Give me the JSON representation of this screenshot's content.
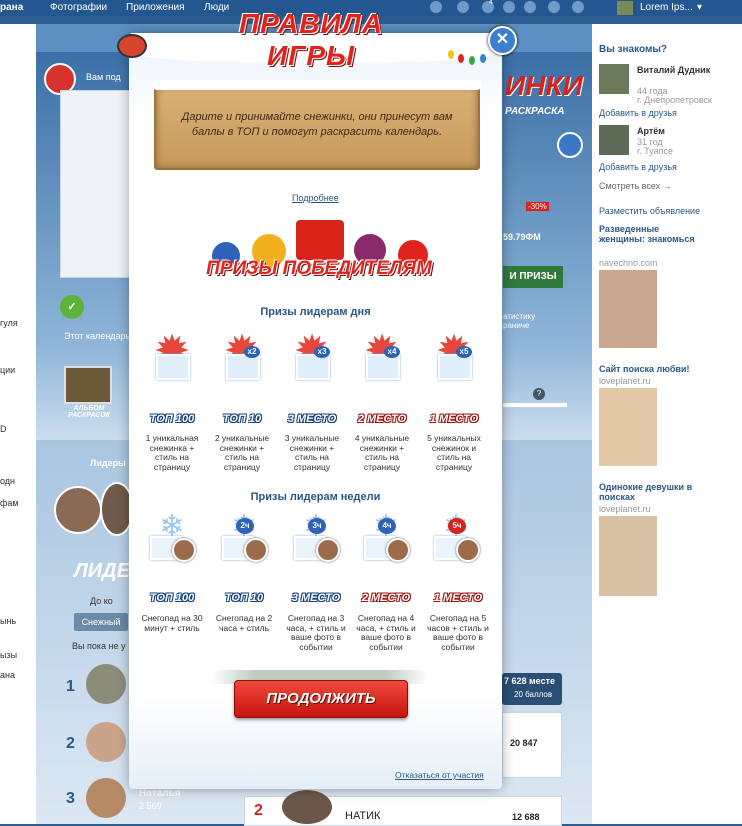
{
  "topbar": {
    "brand_fragment": "рана",
    "nav": [
      "Фотографии",
      "Приложения",
      "Люди"
    ],
    "notification_count": "4",
    "user_name": "Lorem Ips..."
  },
  "modal": {
    "title": "ПРАВИЛА ИГРЫ",
    "rules_text": "Дарите и принимайте снежинки, они принесут вам баллы в ТОП и помогут раскрасить календарь.",
    "more_link": "Подробнее",
    "prizes_banner": "ПРИЗЫ ПОБЕДИТЕЛЯМ",
    "day_section_title": "Призы лидерам дня",
    "week_section_title": "Призы лидерам недели",
    "day_prizes": [
      {
        "place": "ТОП 100",
        "multiplier": "",
        "desc": "1 уникальная снежинка + стиль на страницу"
      },
      {
        "place": "ТОП 10",
        "multiplier": "x2",
        "desc": "2 уникальные снежинки + стиль на страницу"
      },
      {
        "place": "3 МЕСТО",
        "multiplier": "x3",
        "desc": "3 уникальные снежинки + стиль на страницу"
      },
      {
        "place": "2 МЕСТО",
        "multiplier": "x4",
        "desc": "4 уникальные снежинки + стиль на страницу"
      },
      {
        "place": "1 МЕСТО",
        "multiplier": "x5",
        "desc": "5 уникальных снежинок и стиль на страницу"
      }
    ],
    "week_prizes": [
      {
        "place": "ТОП 100",
        "badge": "",
        "desc": "Снегопад на 30 минут + стиль"
      },
      {
        "place": "ТОП 10",
        "badge": "2ч",
        "desc": "Снегопад на 2 часа + стиль"
      },
      {
        "place": "3 МЕСТО",
        "badge": "3ч",
        "desc": "Снегопад на 3 часа, + стиль и ваше фото в событии"
      },
      {
        "place": "2 МЕСТО",
        "badge": "4ч",
        "desc": "Снегопад на 4 часа, + стиль и ваше фото в событии"
      },
      {
        "place": "1 МЕСТО",
        "badge": "5ч",
        "desc": "Снегопад на 5 часов + стиль и ваше фото в событии"
      }
    ],
    "continue_label": "ПРОДОЛЖИТЬ",
    "decline_link": "Отказаться от участия"
  },
  "background": {
    "gift_text": "Вам под",
    "calendar_caption": "Этот календарь",
    "album_label": "АЛЬБОМ РАСКРАСОК",
    "leaders_label": "Лидеры",
    "leaders_banner": "ЛИДЕР",
    "until_text": "До ко",
    "tab_snow": "Снежный",
    "not_yet_text": "Вы пока не у",
    "banner_right": "ИНКИ",
    "banner_right_sub": "РАСКРАСКА",
    "discount": "-30%",
    "price": "59.79ФМ",
    "prizes_btn": "И ПРИЗЫ",
    "stats_link": "атистику раниче",
    "place_text": "7 628 месте",
    "points_text": "20 баллов",
    "scores": [
      "20 847",
      "12 688"
    ],
    "list_names": [
      "Наталья",
      "НАТИК"
    ],
    "list_points": [
      "2 569"
    ],
    "ranks": [
      "1",
      "2",
      "3"
    ],
    "left_snippets": [
      "гуля",
      "ции",
      "D",
      "одн",
      "фам",
      "ынь",
      "ызы",
      "ана"
    ]
  },
  "sidebar": {
    "know_title": "Вы знакомы?",
    "people": [
      {
        "name": "Виталий Дудник",
        "age": "44 года",
        "city": "г. Днепропетровск"
      },
      {
        "name": "Артём",
        "age": "31 год",
        "city": "г. Туапсе"
      }
    ],
    "add_friend": "Добавить в друзья",
    "see_all": "Смотреть всех →",
    "place_ad": "Разместить объявление",
    "ads": [
      {
        "title": "Разведенные женщины: знакомься",
        "domain": "navechno.com"
      },
      {
        "title": "Сайт поиска любви!",
        "domain": "loveplanet.ru"
      },
      {
        "title": "Одинокие девушки в поисках",
        "domain": "loveplanet.ru"
      }
    ]
  },
  "colors": {
    "accent_red": "#e0231d",
    "link_blue": "#2a5885",
    "topbar": "#24578f"
  }
}
